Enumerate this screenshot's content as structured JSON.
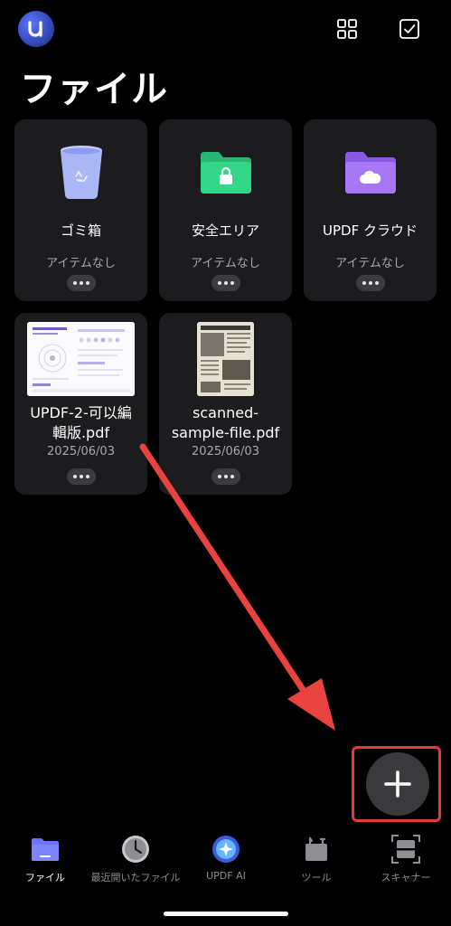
{
  "header": {
    "page_title": "ファイル"
  },
  "folders": [
    {
      "name": "ゴミ箱",
      "status": "アイテムなし",
      "icon": "trash-icon"
    },
    {
      "name": "安全エリア",
      "status": "アイテムなし",
      "icon": "secure-folder-icon"
    },
    {
      "name": "UPDF クラウド",
      "status": "アイテムなし",
      "icon": "cloud-folder-icon"
    }
  ],
  "files": [
    {
      "name": "UPDF-2-可以編輯版.pdf",
      "name_line1": "UPDF-2-可以編",
      "name_line2": "輯版.pdf",
      "date": "2025/06/03"
    },
    {
      "name": "scanned-sample-file.pdf",
      "name_line1": "scanned-",
      "name_line2": "sample-file.pdf",
      "date": "2025/06/03"
    }
  ],
  "tabs": [
    {
      "label": "ファイル",
      "icon": "folder-icon",
      "active": true
    },
    {
      "label": "最近開いたファイル",
      "icon": "clock-icon",
      "active": false
    },
    {
      "label": "UPDF AI",
      "icon": "ai-icon",
      "active": false
    },
    {
      "label": "ツール",
      "icon": "toolbox-icon",
      "active": false
    },
    {
      "label": "スキャナー",
      "icon": "scanner-icon",
      "active": false
    }
  ],
  "colors": {
    "background": "#000000",
    "card": "#1c1c1e",
    "accent_green": "#2ecb7f",
    "accent_purple": "#9c6cf0",
    "accent_blue": "#6a73ff",
    "annotation_red": "#e53a3a"
  }
}
